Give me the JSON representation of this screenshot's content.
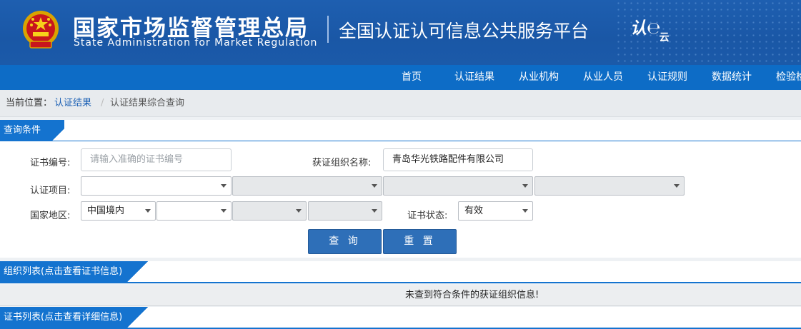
{
  "header": {
    "agency_cn": "国家市场监督管理总局",
    "agency_en": "State Administration  for  Market Regulation",
    "platform_title": "全国认证认可信息公共服务平台",
    "logo_text_main": "认",
    "logo_text_sub": "云"
  },
  "nav": {
    "items": [
      "首页",
      "认证结果",
      "从业机构",
      "从业人员",
      "认证规则",
      "数据统计",
      "检验检"
    ]
  },
  "breadcrumb": {
    "prefix": "当前位置：",
    "link": "认证结果",
    "sep": "/",
    "current": "认证结果综合查询"
  },
  "query": {
    "section_title": "查询条件",
    "cert_no_label": "证书编号:",
    "cert_no_placeholder": "请输入准确的证书编号",
    "org_name_label": "获证组织名称:",
    "org_name_value": "青岛华光铁路配件有限公司",
    "project_label": "认证项目:",
    "region_label": "国家地区:",
    "region_value": "中国境内",
    "status_label": "证书状态:",
    "status_value": "有效",
    "search_button": "查 询",
    "reset_button": "重 置"
  },
  "org_list": {
    "section_title": "组织列表(点击查看证书信息)",
    "empty_message": "未查到符合条件的获证组织信息!"
  },
  "cert_list": {
    "section_title": "证书列表(点击查看详细信息)"
  },
  "colors": {
    "header_blue": "#1a57a6",
    "nav_blue": "#0d6cc6",
    "button_blue": "#2e6fb8",
    "link_blue": "#1a5fb4"
  }
}
